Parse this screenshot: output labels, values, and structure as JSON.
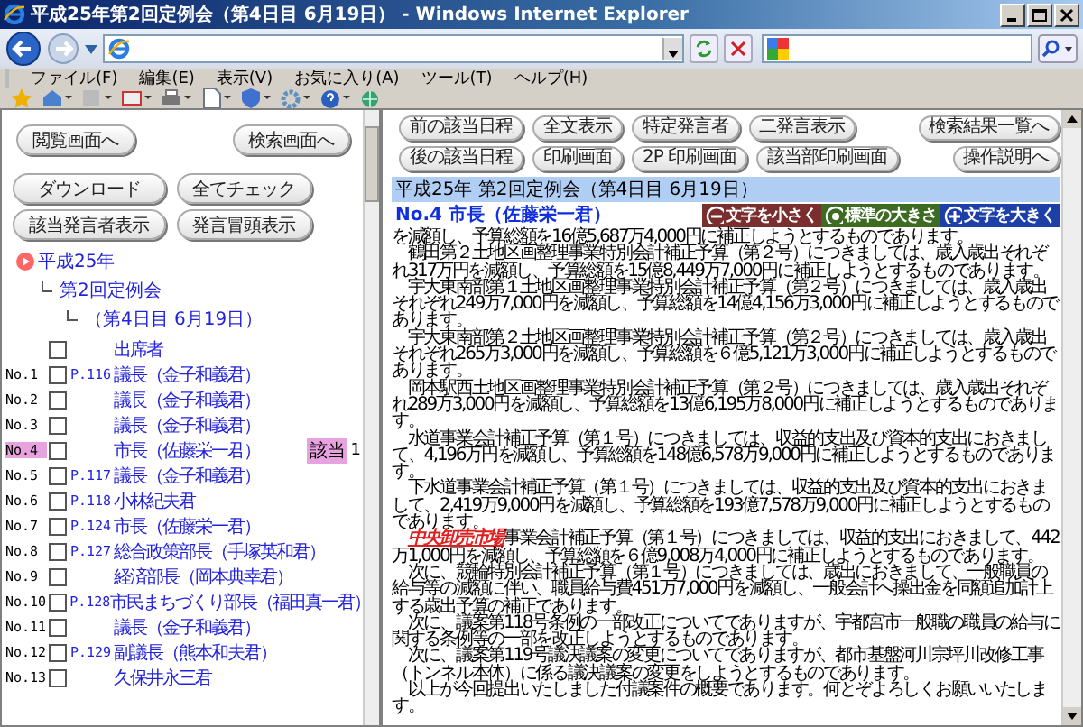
{
  "window": {
    "title": "平成25年第2回定例会（第4日目 6月19日） - Windows Internet Explorer"
  },
  "menu": [
    "ファイル(F)",
    "編集(E)",
    "表示(V)",
    "お気に入り(A)",
    "ツール(T)",
    "ヘルプ(H)"
  ],
  "left_frame": {
    "nav_buttons": [
      "閲覧画面へ",
      "検索画面へ"
    ],
    "action_buttons": [
      "ダウンロード",
      "全てチェック",
      "該当発言者表示",
      "発言冒頭表示"
    ],
    "tree": [
      {
        "label": "平成25年",
        "children": [
          {
            "label": "第2回定例会",
            "children": [
              {
                "label": "（第4日目 6月19日）"
              }
            ]
          }
        ]
      }
    ],
    "speakers": [
      {
        "name": "出席者",
        "checked": false,
        "selected": false
      },
      {
        "no": "No.1",
        "page": "P.116",
        "name": "議長（金子和義君）",
        "checked": false,
        "selected": false
      },
      {
        "no": "No.2",
        "name": "議長（金子和義君）",
        "checked": false,
        "selected": false
      },
      {
        "no": "No.3",
        "name": "議長（金子和義君）",
        "checked": false,
        "selected": false
      },
      {
        "no": "No.4",
        "name": "市長（佐藤栄一君）",
        "checked": false,
        "selected": true,
        "badge": "該当",
        "count": "1"
      },
      {
        "no": "No.5",
        "page": "P.117",
        "name": "議長（金子和義君）",
        "checked": false,
        "selected": false
      },
      {
        "no": "No.6",
        "page": "P.118",
        "name": "小林紀夫君",
        "checked": false,
        "selected": false
      },
      {
        "no": "No.7",
        "page": "P.124",
        "name": "市長（佐藤栄一君）",
        "checked": false,
        "selected": false
      },
      {
        "no": "No.8",
        "page": "P.127",
        "name": "総合政策部長（手塚英和君）",
        "checked": false,
        "selected": false
      },
      {
        "no": "No.9",
        "name": "経済部長（岡本典幸君）",
        "checked": false,
        "selected": false
      },
      {
        "no": "No.10",
        "page": "P.128",
        "name": "市民まちづくり部長（福田真一君）",
        "checked": false,
        "selected": false
      },
      {
        "no": "No.11",
        "name": "議長（金子和義君）",
        "checked": false,
        "selected": false
      },
      {
        "no": "No.12",
        "page": "P.129",
        "name": "副議長（熊本和夫君）",
        "checked": false,
        "selected": false
      },
      {
        "no": "No.13",
        "name": "久保井永三君",
        "checked": false,
        "selected": false
      }
    ]
  },
  "right_frame": {
    "button_rows": [
      {
        "buttons": [
          "前の該当日程",
          "全文表示",
          "特定発言者",
          "二発言表示"
        ],
        "end_button": "検索結果一覧へ"
      },
      {
        "buttons": [
          "後の該当日程",
          "印刷画面",
          "2P 印刷画面",
          "該当部印刷画面"
        ],
        "end_button": "操作説明へ"
      }
    ],
    "session_title": "平成25年 第2回定例会（第4日目 6月19日）",
    "speaker_heading": "No.4 市長（佐藤栄一君）",
    "font_buttons": [
      {
        "kind": "minus",
        "label": "文字を小さく",
        "color": "#7b2e2e"
      },
      {
        "kind": "dot",
        "label": "標準の大きさ",
        "color": "#3d6b22"
      },
      {
        "kind": "plus",
        "label": "文字を大きく",
        "color": "#1c3fa8"
      }
    ],
    "paragraphs": [
      "を減額し、予算総額を16億5,687万4,000円に補正しようとするものであります。",
      "　鶴田第２土地区画整理事業特別会計補正予算（第２号）につきましては、歳入歳出それぞれ317万円を減額し、予算総額を15億8,449万7,000円に補正しようとするものであります。",
      "　宇大東南部第１土地区画整理事業特別会計補正予算（第２号）につきましては、歳入歳出それぞれ249万7,000円を減額し、予算総額を14億4,156万3,000円に補正しようとするものであります。",
      "　宇大東南部第２土地区画整理事業特別会計補正予算（第２号）につきましては、歳入歳出それぞれ265万3,000円を減額し、予算総額を６億5,121万3,000円に補正しようとするものであります。",
      "　岡本駅西土地区画整理事業特別会計補正予算（第２号）につきましては、歳入歳出それぞれ289万3,000円を減額し、予算総額を13億6,195万8,000円に補正しようとするものであります。",
      "　水道事業会計補正予算（第１号）につきましては、収益的支出及び資本的支出におきまして、4,196万円を減額し、予算総額を148億6,578万9,000円に補正しようとするものであります。",
      "　下水道事業会計補正予算（第１号）につきましては、収益的支出及び資本的支出におきまして、2,419万9,000円を減額し、予算総額を193億7,578万9,000円に補正しようとするものであります。",
      "　**中央卸売市場**事業会計補正予算（第１号）につきましては、収益的支出におきまして、442万1,000円を減額し、予算総額を６億9,008万4,000円に補正しようとするものであります。",
      "　次に、競輪特別会計補正予算（第１号）につきましては、歳出におきまして、一般職員の給与等の減額に伴い、職員給与費451万7,000円を減額し、一般会計へ操出金を同額追加計上する歳出予算の補正であります。",
      "　次に、議案第118号条例の一部改正についてでありますが、宇都宮市一般職の職員の給与に関する条例等の一部を改正しようとするものであります。",
      "　次に、議案第119号議決議案の変更についてでありますが、都市基盤河川宗坪川改修工事（トンネル本体）に係る議決議案の変更をしようとするものであります。",
      "　以上が今回提出いたしました付議案件の概要であります。何とぞよろしくお願いいたします。"
    ]
  }
}
